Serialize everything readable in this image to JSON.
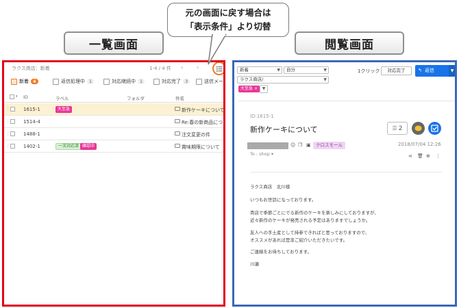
{
  "callout": {
    "line1": "元の画面に戻す場合は",
    "line2": "「表示条件」より切替"
  },
  "titles": {
    "left": "一覧画面",
    "right": "閲覧画面"
  },
  "list": {
    "breadcrumb": "ラクス商店：新着",
    "pager": "1-4 / 4 件",
    "prev": "‹",
    "next": "›",
    "tabs": [
      {
        "label": "新着",
        "count": "4"
      },
      {
        "label": "返信処理中",
        "count": "1"
      },
      {
        "label": "対応継続中",
        "count": "1"
      },
      {
        "label": "対応完了",
        "count": "3"
      },
      {
        "label": "送信メール",
        "count": ""
      }
    ],
    "columns": {
      "id": "ID",
      "label": "ラベル",
      "folder": "フォルダ",
      "subject": "件名"
    },
    "rows": [
      {
        "id": "1615-1",
        "labels": [
          "大至急"
        ],
        "subject": "新作ケーキについて"
      },
      {
        "id": "1514-4",
        "labels": [],
        "subject": "Re:春の新商品につい…"
      },
      {
        "id": "1488-1",
        "labels": [],
        "subject": "注文変更の件"
      },
      {
        "id": "1402-1",
        "labels": [
          "一次対応済",
          "確認中"
        ],
        "subject": "賞味期限について"
      }
    ]
  },
  "detail": {
    "select_status": "新着",
    "select_owner": "自分",
    "select_folder": "ラクス商店/",
    "oneclick": "1クリック",
    "done_button": "対応完了",
    "reply_button": "返信",
    "chip_label": "大至急",
    "chip_remove": "×",
    "mail_id": "ID:1615-1",
    "mail_title": "新作ケーキについて",
    "comment_count": "2",
    "tag": "クロスモール",
    "date": "2018/07/04 12:26",
    "to": "To : shop",
    "body": [
      "ラクス商店　北川様",
      "いつもお世話になっております。",
      "貴店で季節ごとにでる新作のケーキを楽しみにしておりますが、",
      "近々新作のケーキが発売される予定はありますでしょうか。",
      "友人への手土産として持参できればと思っておりますので、",
      "オススメがあれば是非ご紹介いただきたいです。",
      "ご連絡をお待ちしております。",
      "川瀬"
    ]
  },
  "colors": {
    "left_frame": "#e3001b",
    "right_frame": "#3a67b8",
    "accent": "#f07b21",
    "reply": "#1a73e8"
  }
}
